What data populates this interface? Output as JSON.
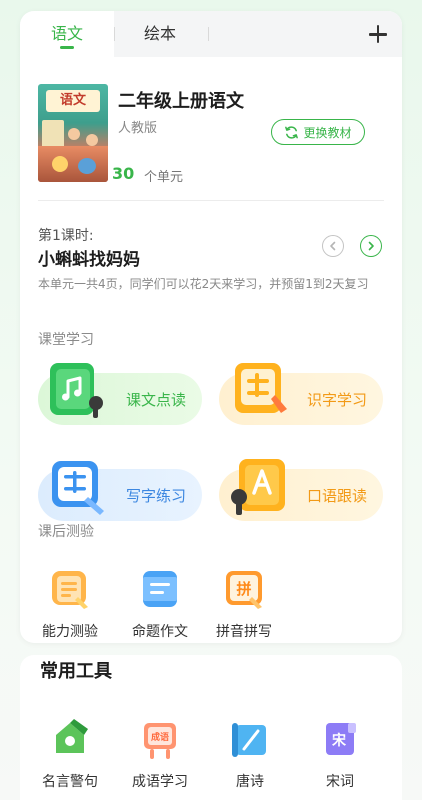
{
  "tabs": [
    {
      "label": "语文",
      "active": true
    },
    {
      "label": "绘本",
      "active": false
    }
  ],
  "add_icon": "plus-icon",
  "book": {
    "cover_text": "语文",
    "title": "二年级上册语文",
    "publisher": "人教版",
    "unit_count": "30",
    "unit_label": "个单元",
    "change_button": "更换教材"
  },
  "lesson": {
    "label": "第1课时:",
    "title": "小蝌蚪找妈妈",
    "description": "本单元一共4页，同学们可以花2天来学习，并预留1到2天复习"
  },
  "classroom": {
    "label": "课堂学习",
    "items": [
      {
        "label": "课文点读",
        "icon": "music-book-icon"
      },
      {
        "label": "识字学习",
        "icon": "character-learn-icon"
      },
      {
        "label": "写字练习",
        "icon": "writing-practice-icon"
      },
      {
        "label": "口语跟读",
        "icon": "oral-reading-icon"
      }
    ]
  },
  "quiz": {
    "label": "课后测验",
    "items": [
      {
        "label": "能力测验",
        "icon": "ability-test-icon"
      },
      {
        "label": "命题作文",
        "icon": "composition-icon"
      },
      {
        "label": "拼音拼写",
        "icon": "pinyin-icon",
        "badge": "拼"
      }
    ]
  },
  "tools": {
    "title": "常用工具",
    "items": [
      {
        "label": "名言警句",
        "icon": "quote-icon"
      },
      {
        "label": "成语学习",
        "icon": "idiom-icon",
        "badge": "成语"
      },
      {
        "label": "唐诗",
        "icon": "tang-poem-icon"
      },
      {
        "label": "宋词",
        "icon": "song-ci-icon",
        "badge": "宋"
      }
    ]
  },
  "colors": {
    "accent_green": "#39b54a",
    "accent_orange": "#f29a16",
    "accent_blue": "#3b86e0"
  }
}
